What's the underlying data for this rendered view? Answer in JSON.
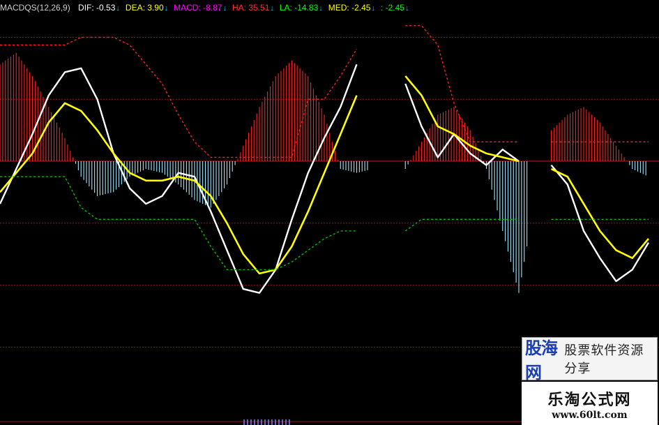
{
  "legend": {
    "name": "MACDQS(12,26,9)",
    "items": [
      {
        "label": "DIF:",
        "value": "-0.53",
        "color": "#ffffff",
        "arrow": "↓",
        "arrow_color": "#00c8ff"
      },
      {
        "label": "DEA:",
        "value": "3.90",
        "color": "#ffff00",
        "arrow": "↓",
        "arrow_color": "#00c8ff"
      },
      {
        "label": "MACD:",
        "value": "-8.87",
        "color": "#ff00ff",
        "arrow": "↓",
        "arrow_color": "#00c8ff"
      },
      {
        "label": "HA:",
        "value": "35.51",
        "color": "#ff3030",
        "arrow": "↓",
        "arrow_color": "#00c8ff"
      },
      {
        "label": "LA:",
        "value": "-14.83",
        "color": "#00ff00",
        "arrow": "↓",
        "arrow_color": "#00c8ff"
      },
      {
        "label": "MED:",
        "value": "-2.45",
        "color": "#ffff00",
        "arrow": "↓",
        "arrow_color": "#00c8ff"
      },
      {
        "label": ":",
        "value": "-2.45",
        "color": "#00ff00",
        "arrow": "↓",
        "arrow_color": "#00c8ff"
      }
    ]
  },
  "watermark": {
    "brand": "股海网",
    "slogan": "股票软件资源分享",
    "site": "乐淘公式网",
    "url": "www.60lt.com"
  },
  "colors": {
    "background": "#000000",
    "grid": "#a01010",
    "dif": "#ffffff",
    "dea": "#ffff00",
    "ha": "#ff2020",
    "la": "#00c000",
    "hist_pos": "#ff2020",
    "hist_neg": "#9fe8ff"
  },
  "chart_data": {
    "type": "line",
    "ylim": [
      -40,
      40
    ],
    "grid_values": [
      32,
      16,
      0,
      -16,
      -32,
      -48
    ],
    "gaps": [
      [
        91,
        99
      ],
      [
        130,
        136
      ]
    ],
    "x": [
      0,
      4,
      8,
      12,
      16,
      20,
      24,
      28,
      32,
      36,
      40,
      44,
      48,
      52,
      56,
      60,
      64,
      68,
      72,
      76,
      80,
      84,
      88,
      92,
      96,
      100,
      104,
      108,
      112,
      116,
      120,
      124,
      128,
      132,
      136,
      140,
      144,
      148,
      152,
      156,
      160
    ],
    "series": [
      {
        "name": "DIF",
        "values": [
          -11,
          -2,
          7,
          17,
          23,
          24,
          16,
          2,
          -7,
          -11,
          -9,
          -3,
          -4,
          -13,
          -23,
          -33,
          -34,
          -28,
          -15,
          -3,
          6,
          14,
          25,
          31,
          28,
          20,
          9,
          1,
          7,
          2,
          -1,
          3,
          0,
          -4,
          -1,
          -6,
          -18,
          -25,
          -31,
          -28,
          -21
        ],
        "color": "#ffffff"
      },
      {
        "name": "DEA",
        "values": [
          -8,
          -3,
          2,
          10,
          15,
          13,
          8,
          2,
          -3,
          -5,
          -5,
          -4,
          -5,
          -9,
          -16,
          -24,
          -29,
          -28,
          -22,
          -13,
          -3,
          7,
          17,
          25,
          27,
          22,
          17,
          9,
          7,
          4,
          2,
          1,
          0,
          -1,
          -2,
          -4,
          -11,
          -18,
          -23,
          -25,
          -20
        ],
        "color": "#ffff00"
      },
      {
        "name": "HA",
        "values": [
          30,
          30,
          30,
          30,
          30,
          32,
          32,
          32,
          30,
          25,
          20,
          12,
          5,
          1,
          1,
          1,
          1,
          1,
          1,
          16,
          16,
          22,
          29,
          35,
          35,
          35,
          35,
          30,
          15,
          5,
          5,
          5,
          5,
          5,
          5,
          5,
          5,
          5,
          5,
          5,
          5
        ],
        "color": "#ff2020"
      },
      {
        "name": "LA",
        "values": [
          -4,
          -4,
          -4,
          -4,
          -4,
          -12,
          -15,
          -15,
          -15,
          -15,
          -15,
          -15,
          -15,
          -22,
          -28,
          -28,
          -28,
          -28,
          -26,
          -23,
          -20,
          -18,
          -18,
          -18,
          -18,
          -18,
          -15,
          -15,
          -15,
          -15,
          -15,
          -15,
          -15,
          -15,
          -15,
          -15,
          -15,
          -15,
          -15,
          -15,
          -15
        ],
        "color": "#00c000"
      }
    ],
    "histogram": [
      {
        "x": 0,
        "value": 25
      },
      {
        "x": 4,
        "value": 28
      },
      {
        "x": 8,
        "value": 22
      },
      {
        "x": 12,
        "value": 14
      },
      {
        "x": 16,
        "value": 6
      },
      {
        "x": 20,
        "value": -4
      },
      {
        "x": 24,
        "value": -9
      },
      {
        "x": 28,
        "value": -8
      },
      {
        "x": 32,
        "value": -4
      },
      {
        "x": 36,
        "value": -2
      },
      {
        "x": 40,
        "value": -3
      },
      {
        "x": 44,
        "value": -6
      },
      {
        "x": 48,
        "value": -10
      },
      {
        "x": 52,
        "value": -12
      },
      {
        "x": 56,
        "value": -6
      },
      {
        "x": 60,
        "value": 4
      },
      {
        "x": 64,
        "value": 14
      },
      {
        "x": 68,
        "value": 22
      },
      {
        "x": 72,
        "value": 26
      },
      {
        "x": 76,
        "value": 22
      },
      {
        "x": 80,
        "value": 12
      },
      {
        "x": 84,
        "value": -2
      },
      {
        "x": 88,
        "value": -3
      },
      {
        "x": 92,
        "value": -2
      },
      {
        "x": 100,
        "value": -2
      },
      {
        "x": 104,
        "value": 5
      },
      {
        "x": 108,
        "value": 12
      },
      {
        "x": 112,
        "value": 14
      },
      {
        "x": 116,
        "value": 8
      },
      {
        "x": 120,
        "value": -2
      },
      {
        "x": 124,
        "value": -18
      },
      {
        "x": 128,
        "value": -34
      },
      {
        "x": 132,
        "value": -10
      },
      {
        "x": 136,
        "value": 8
      },
      {
        "x": 140,
        "value": 12
      },
      {
        "x": 144,
        "value": 14
      },
      {
        "x": 148,
        "value": 10
      },
      {
        "x": 152,
        "value": 4
      },
      {
        "x": 156,
        "value": -2
      },
      {
        "x": 160,
        "value": -4
      }
    ]
  }
}
